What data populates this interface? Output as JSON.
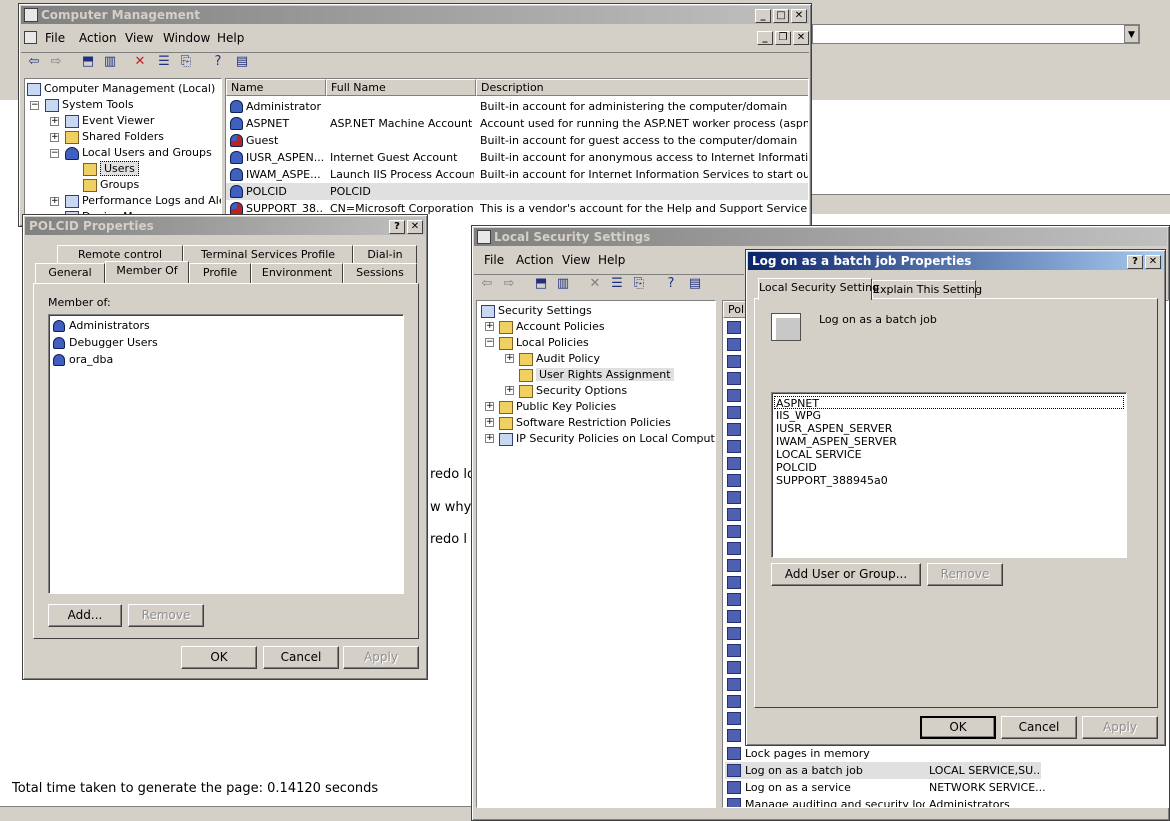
{
  "comp_mgmt": {
    "title": "Computer Management",
    "menus": [
      "File",
      "Action",
      "View",
      "Window",
      "Help"
    ],
    "tree": [
      "Computer Management (Local)",
      "System Tools",
      "Event Viewer",
      "Shared Folders",
      "Local Users and Groups",
      "Users",
      "Groups",
      "Performance Logs and Alerts",
      "Device Manager"
    ],
    "columns": [
      "Name",
      "Full Name",
      "Description"
    ],
    "rows": [
      {
        "name": "Administrator",
        "full": "",
        "desc": "Built-in account for administering the computer/domain"
      },
      {
        "name": "ASPNET",
        "full": "ASP.NET Machine Account",
        "desc": "Account used for running the ASP.NET worker process (aspnet_wp.e"
      },
      {
        "name": "Guest",
        "full": "",
        "desc": "Built-in account for guest access to the computer/domain"
      },
      {
        "name": "IUSR_ASPEN...",
        "full": "Internet Guest Account",
        "desc": "Built-in account for anonymous access to Internet Information Servic"
      },
      {
        "name": "IWAM_ASPE...",
        "full": "Launch IIS Process Account",
        "desc": "Built-in account for Internet Information Services to start out of proc"
      },
      {
        "name": "POLCID",
        "full": "POLCID",
        "desc": ""
      },
      {
        "name": "SUPPORT_38...",
        "full": "CN=Microsoft Corporation...",
        "desc": "This is a vendor's account for the Help and Support Service"
      }
    ]
  },
  "polcid": {
    "title": "POLCID Properties",
    "tabs_row1": [
      "Remote control",
      "Terminal Services Profile",
      "Dial-in"
    ],
    "tabs_row2": [
      "General",
      "Member Of",
      "Profile",
      "Environment",
      "Sessions"
    ],
    "member_label": "Member of:",
    "members": [
      "Administrators",
      "Debugger Users",
      "ora_dba"
    ],
    "add": "Add...",
    "remove": "Remove",
    "ok": "OK",
    "cancel": "Cancel",
    "apply": "Apply"
  },
  "lss": {
    "title": "Local Security Settings",
    "menus": [
      "File",
      "Action",
      "View",
      "Help"
    ],
    "tree": [
      "Security Settings",
      "Account Policies",
      "Local Policies",
      "Audit Policy",
      "User Rights Assignment",
      "Security Options",
      "Public Key Policies",
      "Software Restriction Policies",
      "IP Security Policies on Local Computer"
    ],
    "policy_header": "Poli",
    "policy_rows": [
      {
        "name": "Lock pages in memory",
        "value": ""
      },
      {
        "name": "Log on as a batch job",
        "value": "LOCAL SERVICE,SU..."
      },
      {
        "name": "Log on as a service",
        "value": "NETWORK SERVICE..."
      },
      {
        "name": "Manage auditing and security log",
        "value": "Administrators"
      }
    ]
  },
  "batch": {
    "title": "Log on as a batch job Properties",
    "tab1": "Local Security Setting",
    "tab2": "Explain This Setting",
    "heading": "Log on as a batch job",
    "accounts": [
      "ASPNET",
      "IIS_WPG",
      "IUSR_ASPEN_SERVER",
      "IWAM_ASPEN_SERVER",
      "LOCAL SERVICE",
      "POLCID",
      "SUPPORT_388945a0"
    ],
    "add": "Add User or Group...",
    "remove": "Remove",
    "ok": "OK",
    "cancel": "Cancel",
    "apply": "Apply"
  },
  "web": {
    "frag1": "redo lo",
    "frag2": "w why",
    "frag3": "redo l",
    "footer": "Total time taken to generate the page: 0.14120 seconds"
  }
}
